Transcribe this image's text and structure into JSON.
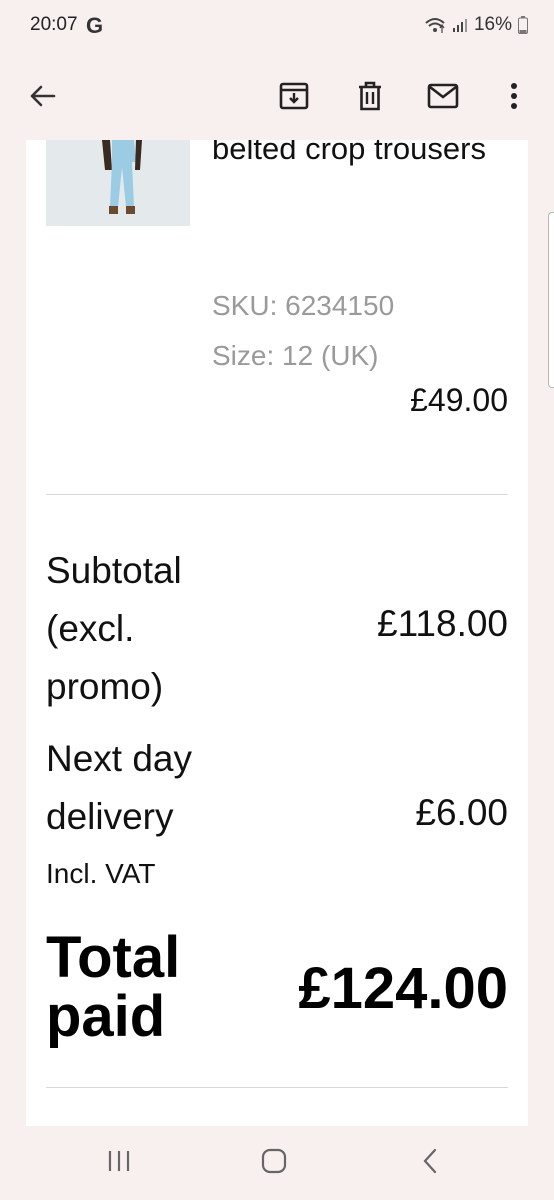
{
  "status_bar": {
    "time": "20:07",
    "google_glyph": "G",
    "battery": "16%"
  },
  "toolbar": {
    "back_icon": "arrow-back-icon",
    "archive_icon": "archive-icon",
    "delete_icon": "trash-icon",
    "mark_unread_icon": "mail-icon",
    "more_icon": "more-vert-icon"
  },
  "order_item": {
    "name": "belted crop trousers",
    "sku": "SKU: 6234150",
    "size": "Size: 12 (UK)",
    "price": "£49.00"
  },
  "summary": {
    "subtotal_label": "Subtotal (excl. promo)",
    "subtotal_value": "£118.00",
    "delivery_label": "Next day delivery",
    "delivery_value": "£6.00",
    "vat_note": "Incl. VAT",
    "total_label": "Total paid",
    "total_value": "£124.00"
  },
  "nav_bar": {
    "recent_icon": "recent-apps-icon",
    "home_icon": "home-icon",
    "back_icon": "nav-back-icon"
  },
  "colors": {
    "chrome_background": "#f8f0ee",
    "content_background": "#ffffff",
    "muted_text": "#9a9a9a",
    "product_image_bg": "#e4e9ec",
    "product_denim": "#9ccbe4"
  }
}
